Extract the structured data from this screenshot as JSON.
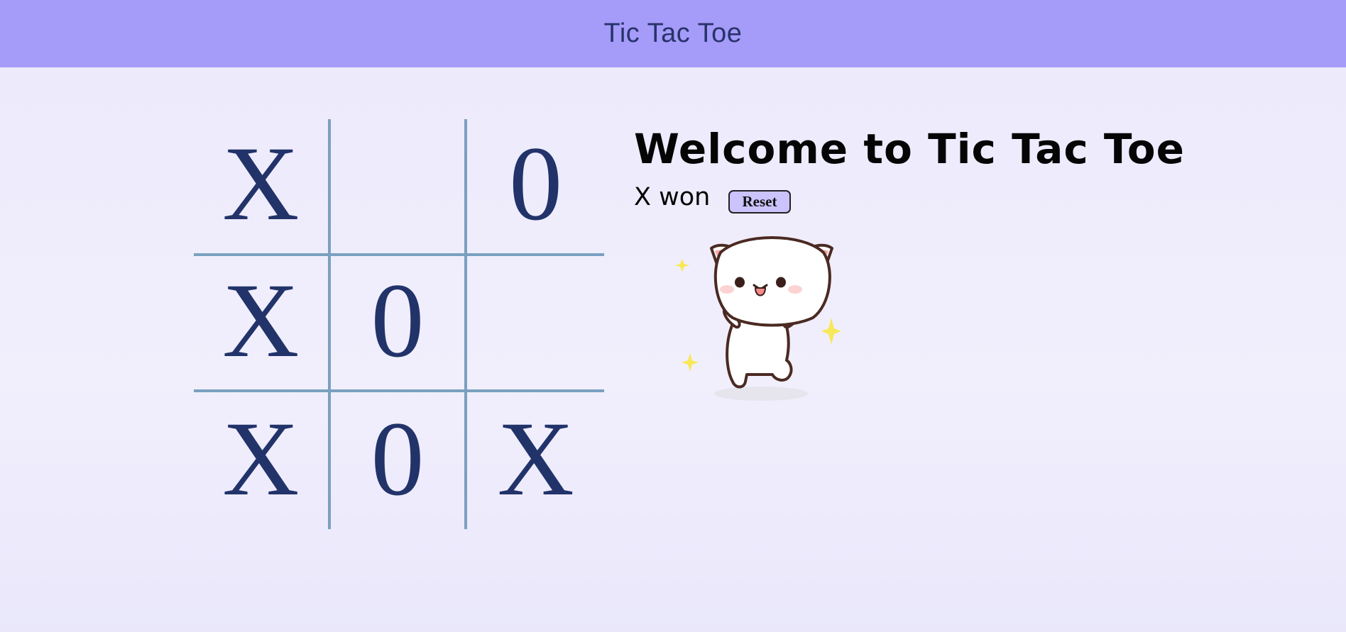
{
  "header": {
    "title": "Tic Tac Toe"
  },
  "main": {
    "heading": "Welcome to Tic Tac Toe",
    "status": "X won",
    "reset_label": "Reset"
  },
  "board": {
    "cells": [
      "X",
      "",
      "0",
      "X",
      "0",
      "",
      "X",
      "0",
      "X"
    ]
  },
  "colors": {
    "header_bg": "#a59bf9",
    "mark": "#22336a",
    "grid_line": "#7aa0c0",
    "button_bg": "#cbc3fb"
  },
  "illustration": {
    "icon": "cheering-cat-icon"
  }
}
